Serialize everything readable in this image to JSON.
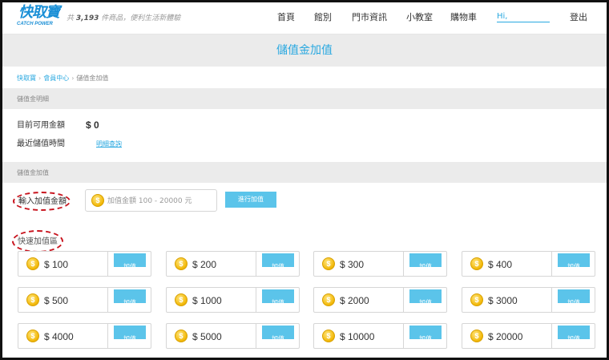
{
  "header": {
    "logo_text": "快取寶",
    "logo_sub": "CATCH POWER",
    "tagline_prefix": "共",
    "tagline_count": "3,193",
    "tagline_suffix": "件商品，便利生活新體驗",
    "nav": [
      "首頁",
      "館別",
      "門市資訊",
      "小教室",
      "購物車"
    ],
    "greeting": "Hi,",
    "logout": "登出"
  },
  "page_title": "儲值金加值",
  "breadcrumb": [
    "快取寶",
    "會員中心",
    "儲值金加值"
  ],
  "details_section": {
    "heading": "儲值金明細",
    "balance_label": "目前可用金額",
    "balance_value": "$ 0",
    "recent_label": "最近儲值時間",
    "history_link": "明細查詢"
  },
  "topup_section": {
    "heading": "儲值金加值",
    "amount_label": "輸入加值金額",
    "amount_placeholder": "加值金額 100 - 20000 元",
    "amount_value": "",
    "submit_label": "進行加值",
    "quick_label": "快速加值區",
    "coin_symbol": "$",
    "quick_button_label": "加值",
    "quick_amounts": [
      "$ 100",
      "$ 200",
      "$ 300",
      "$ 400",
      "$ 500",
      "$ 1000",
      "$ 2000",
      "$ 3000",
      "$ 4000",
      "$ 5000",
      "$ 10000",
      "$ 20000"
    ]
  },
  "colors": {
    "accent": "#29a8e0",
    "button": "#5bc4ea",
    "section_bg": "#ebebeb",
    "annotation": "#c8141e",
    "coin": "#f2b705"
  }
}
